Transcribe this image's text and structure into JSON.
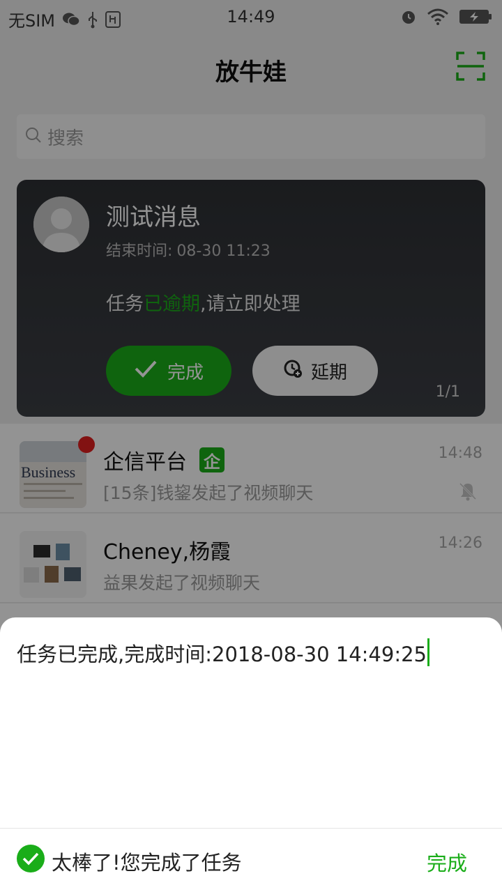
{
  "status_bar": {
    "carrier": "无SIM",
    "time": "14:49",
    "icons": [
      "wechat-icon",
      "usb-icon",
      "usb-debug-icon",
      "alarm-icon",
      "wifi-icon",
      "battery-charging-icon"
    ]
  },
  "nav": {
    "title": "放牛娃",
    "scan_icon": "scan-icon"
  },
  "search": {
    "placeholder": "搜索"
  },
  "task_card": {
    "title": "测试消息",
    "end_time_label": "结束时间:",
    "end_time_value": "08-30 11:23",
    "status_prefix": "任务",
    "status_overdue": "已逾期",
    "status_suffix": ",请立即处理",
    "done_label": "完成",
    "delay_label": "延期",
    "pager": "1/1"
  },
  "conversations": [
    {
      "name": "企信平台",
      "badge": "企",
      "preview": "[15条]钱鋆发起了视频聊天",
      "time": "14:48",
      "unread_dot": true,
      "muted": true,
      "thumb_text": "Business"
    },
    {
      "name": "Cheney,杨霞",
      "preview": "益果发起了视频聊天",
      "time": "14:26"
    }
  ],
  "sheet": {
    "message": "任务已完成,完成时间:2018-08-30 14:49:25",
    "footer_text": "太棒了!您完成了任务",
    "done_label": "完成"
  },
  "colors": {
    "accent_green": "#1aad19",
    "card_bg": "#2e3034",
    "unread_red": "#e02020"
  }
}
